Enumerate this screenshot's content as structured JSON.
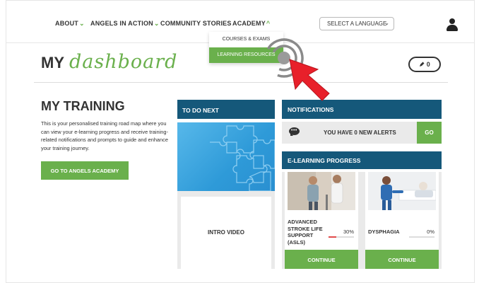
{
  "nav": {
    "items": [
      {
        "label": "ABOUT",
        "chevron": "⌄"
      },
      {
        "label": "ANGELS IN ACTION",
        "chevron": "⌄"
      },
      {
        "label": "COMMUNITY STORIES",
        "chevron": ""
      },
      {
        "label": "ACADEMY",
        "chevron": "^"
      }
    ],
    "language_select": "SELECT A LANGUAGE",
    "language_caret": "⌄",
    "user_icon": "user-icon"
  },
  "dropdown": {
    "items": [
      {
        "label": "COURSES & EXAMS"
      },
      {
        "label": "LEARNING RESOURCES"
      }
    ]
  },
  "dashboard": {
    "title_my": "MY",
    "title_script": "dashboard",
    "points": "0",
    "points_icon": "pencil-icon"
  },
  "training": {
    "title": "MY TRAINING",
    "description": "This is your personalised training road map where you can view your e-learning progress and receive training-related notifications and prompts to guide and enhance your training journey.",
    "button": "GO TO ANGELS ACADEMY"
  },
  "todo": {
    "header": "TO DO NEXT",
    "card_label": "INTRO VIDEO"
  },
  "notifications": {
    "header": "NOTIFICATIONS",
    "alerts_text": "YOU HAVE 0 NEW ALERTS",
    "go_label": "GO",
    "icon": "chat-icon"
  },
  "elearning": {
    "header": "E-LEARNING PROGRESS",
    "courses": [
      {
        "title": "ADVANCED STROKE LIFE SUPPORT (ASLS)",
        "percent": "30%",
        "progress": 0.3,
        "button": "CONTINUE"
      },
      {
        "title": "DYSPHAGIA",
        "percent": "0%",
        "progress": 0,
        "button": "CONTINUE"
      }
    ]
  },
  "colors": {
    "accent_green": "#6ab04c",
    "header_blue": "#15587a",
    "cursor_red": "#e8202a"
  }
}
